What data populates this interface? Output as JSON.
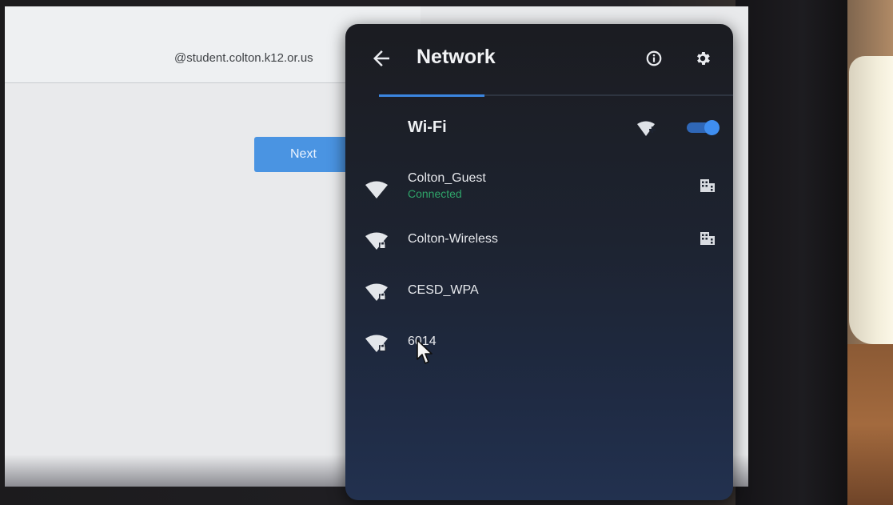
{
  "background": {
    "email_suffix": "@student.colton.k12.or.us",
    "next_label": "Next"
  },
  "network_panel": {
    "title": "Network",
    "icons": {
      "back": "arrow-left-icon",
      "info": "info-icon",
      "settings": "gear-icon"
    },
    "wifi": {
      "label": "Wi-Fi",
      "toggle_on": true,
      "add_icon": "add-wifi-icon"
    },
    "networks": [
      {
        "name": "Colton_Guest",
        "status": "Connected",
        "secured": false,
        "enterprise": true
      },
      {
        "name": "Colton-Wireless",
        "status": "",
        "secured": true,
        "enterprise": true
      },
      {
        "name": "CESD_WPA",
        "status": "",
        "secured": true,
        "enterprise": false
      },
      {
        "name": "6014",
        "status": "",
        "secured": true,
        "enterprise": false
      }
    ]
  },
  "colors": {
    "accent": "#3f8ef0",
    "connected": "#2fa56a",
    "panel_bg": "#1d2330",
    "next_button": "#4a94e2"
  }
}
